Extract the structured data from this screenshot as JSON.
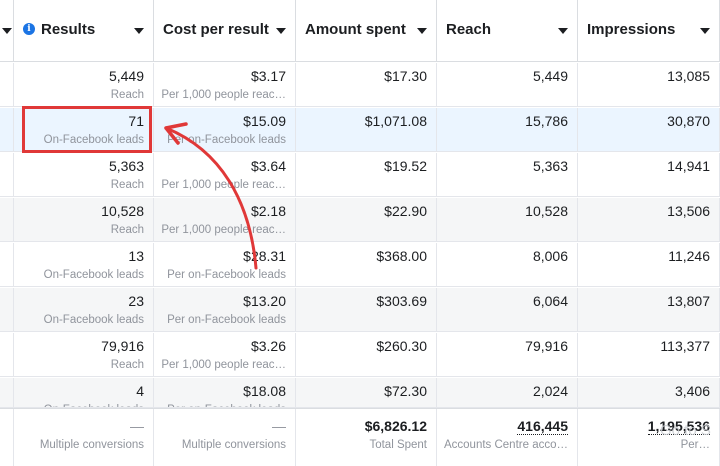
{
  "header": {
    "columns": [
      {
        "label": "Results",
        "info": "i"
      },
      {
        "label": "Cost per result"
      },
      {
        "label": "Amount spent"
      },
      {
        "label": "Reach"
      },
      {
        "label": "Impressions"
      }
    ]
  },
  "rows": [
    {
      "results": "5,449",
      "results_type": "Reach",
      "cost": "$3.17",
      "cost_type": "Per 1,000 people reac…",
      "amount": "$17.30",
      "reach": "5,449",
      "impressions": "13,085"
    },
    {
      "results": "71",
      "results_type": "On-Facebook leads",
      "cost": "$15.09",
      "cost_type": "Per on-Facebook leads",
      "amount": "$1,071.08",
      "reach": "15,786",
      "impressions": "30,870"
    },
    {
      "results": "5,363",
      "results_type": "Reach",
      "cost": "$3.64",
      "cost_type": "Per 1,000 people reac…",
      "amount": "$19.52",
      "reach": "5,363",
      "impressions": "14,941"
    },
    {
      "results": "10,528",
      "results_type": "Reach",
      "cost": "$2.18",
      "cost_type": "Per 1,000 people reac…",
      "amount": "$22.90",
      "reach": "10,528",
      "impressions": "13,506"
    },
    {
      "results": "13",
      "results_type": "On-Facebook leads",
      "cost": "$28.31",
      "cost_type": "Per on-Facebook leads",
      "amount": "$368.00",
      "reach": "8,006",
      "impressions": "11,246"
    },
    {
      "results": "23",
      "results_type": "On-Facebook leads",
      "cost": "$13.20",
      "cost_type": "Per on-Facebook leads",
      "amount": "$303.69",
      "reach": "6,064",
      "impressions": "13,807"
    },
    {
      "results": "79,916",
      "results_type": "Reach",
      "cost": "$3.26",
      "cost_type": "Per 1,000 people reac…",
      "amount": "$260.30",
      "reach": "79,916",
      "impressions": "113,377"
    },
    {
      "results": "4",
      "results_type": "On-Facebook leads",
      "cost": "$18.08",
      "cost_type": "Per on-Facebook leads",
      "amount": "$72.30",
      "reach": "2,024",
      "impressions": "3,406"
    }
  ],
  "totals": {
    "results": "—",
    "results_type": "Multiple conversions",
    "cost": "—",
    "cost_type": "Multiple conversions",
    "amount": "$6,826.12",
    "amount_type": "Total Spent",
    "reach": "416,445",
    "reach_type": "Accounts Centre acco…",
    "impressions": "1,195,536",
    "impressions_type": "Per…"
  },
  "watermark": "Go to S",
  "colors": {
    "highlight": "#e03838",
    "selected_row": "#ebf5ff",
    "info_icon": "#1b74e4"
  }
}
